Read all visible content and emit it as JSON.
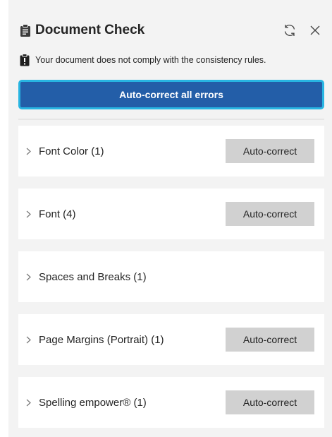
{
  "header": {
    "title": "Document Check"
  },
  "warning": {
    "text": "Your document does not comply with the consistency rules."
  },
  "autocorrect_all_label": "Auto-correct all errors",
  "categories": [
    {
      "label": "Font Color (1)",
      "button": "Auto-correct"
    },
    {
      "label": "Font (4)",
      "button": "Auto-correct"
    },
    {
      "label": "Spaces and Breaks (1)"
    },
    {
      "label": "Page Margins (Portrait) (1)",
      "button": "Auto-correct"
    },
    {
      "label": "Spelling empower® (1)",
      "button": "Auto-correct"
    }
  ],
  "colors": {
    "panel_bg": "#f3f3f3",
    "primary_button": "#235ea8",
    "focus_ring": "#28b5e2",
    "secondary_button": "#d1d1d1"
  },
  "icons": {
    "title": "document-check-icon",
    "refresh": "refresh-icon",
    "close": "close-icon",
    "warning": "clipboard-alert-icon",
    "expand": "chevron-right-icon"
  }
}
